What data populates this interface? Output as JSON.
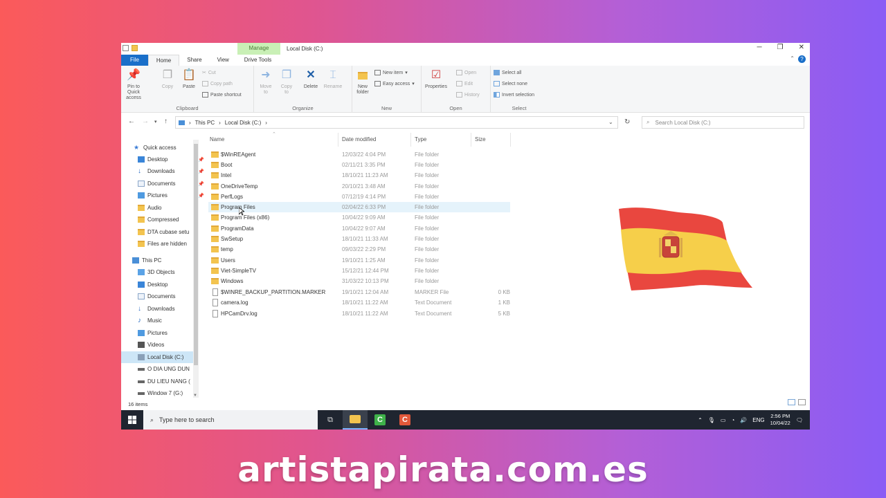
{
  "window": {
    "title": "Local Disk (C:)",
    "manage_tab": "Manage",
    "controls": [
      "─",
      "❐",
      "✕"
    ]
  },
  "ribbon_tabs": [
    "File",
    "Home",
    "Share",
    "View",
    "Drive Tools"
  ],
  "ribbon": {
    "clipboard": {
      "pin_label": "Pin to Quick access",
      "copy": "Copy",
      "paste": "Paste",
      "cut": "Cut",
      "copy_path": "Copy path",
      "paste_shortcut": "Paste shortcut",
      "group": "Clipboard"
    },
    "organize": {
      "move_to": "Move to",
      "copy_to": "Copy to",
      "delete": "Delete",
      "rename": "Rename",
      "group": "Organize"
    },
    "new": {
      "new_folder": "New folder",
      "new_item": "New item",
      "easy_access": "Easy access",
      "group": "New"
    },
    "open": {
      "properties": "Properties",
      "open": "Open",
      "edit": "Edit",
      "history": "History",
      "group": "Open"
    },
    "select": {
      "select_all": "Select all",
      "select_none": "Select none",
      "invert": "Invert selection",
      "group": "Select"
    }
  },
  "address": {
    "path": [
      "This PC",
      "Local Disk (C:)"
    ],
    "search_placeholder": "Search Local Disk (C:)"
  },
  "nav": {
    "quick_access": "Quick access",
    "quick_items": [
      "Desktop",
      "Downloads",
      "Documents",
      "Pictures",
      "Audio",
      "Compressed",
      "DTA cubase setu",
      "Files are hidden"
    ],
    "this_pc": "This PC",
    "pc_items": [
      "3D Objects",
      "Desktop",
      "Documents",
      "Downloads",
      "Music",
      "Pictures",
      "Videos",
      "Local Disk (C:)",
      "O DIA UNG DUN",
      "DU LIEU NANG (",
      "Window 7 (G:)"
    ]
  },
  "columns": {
    "name": "Name",
    "date": "Date modified",
    "type": "Type",
    "size": "Size"
  },
  "files": [
    {
      "name": "$WinREAgent",
      "date": "12/03/22 4:04 PM",
      "type": "File folder",
      "size": ""
    },
    {
      "name": "Boot",
      "date": "02/11/21 3:35 PM",
      "type": "File folder",
      "size": ""
    },
    {
      "name": "Intel",
      "date": "18/10/21 11:23 AM",
      "type": "File folder",
      "size": ""
    },
    {
      "name": "OneDriveTemp",
      "date": "20/10/21 3:48 AM",
      "type": "File folder",
      "size": ""
    },
    {
      "name": "PerfLogs",
      "date": "07/12/19 4:14 PM",
      "type": "File folder",
      "size": ""
    },
    {
      "name": "Program Files",
      "date": "02/04/22 6:33 PM",
      "type": "File folder",
      "size": ""
    },
    {
      "name": "Program Files (x86)",
      "date": "10/04/22 9:09 AM",
      "type": "File folder",
      "size": ""
    },
    {
      "name": "ProgramData",
      "date": "10/04/22 9:07 AM",
      "type": "File folder",
      "size": ""
    },
    {
      "name": "SwSetup",
      "date": "18/10/21 11:33 AM",
      "type": "File folder",
      "size": ""
    },
    {
      "name": "temp",
      "date": "09/03/22 2:29 PM",
      "type": "File folder",
      "size": ""
    },
    {
      "name": "Users",
      "date": "19/10/21 1:25 AM",
      "type": "File folder",
      "size": ""
    },
    {
      "name": "Viet-SimpleTV",
      "date": "15/12/21 12:44 PM",
      "type": "File folder",
      "size": ""
    },
    {
      "name": "Windows",
      "date": "31/03/22 10:13 PM",
      "type": "File folder",
      "size": ""
    },
    {
      "name": "$WINRE_BACKUP_PARTITION.MARKER",
      "date": "19/10/21 12:04 AM",
      "type": "MARKER File",
      "size": "0 KB"
    },
    {
      "name": "camera.log",
      "date": "18/10/21 11:22 AM",
      "type": "Text Document",
      "size": "1 KB"
    },
    {
      "name": "HPCamDrv.log",
      "date": "18/10/21 11:22 AM",
      "type": "Text Document",
      "size": "5 KB"
    }
  ],
  "status": "16 items",
  "taskbar": {
    "search_placeholder": "Type here to search",
    "lang": "ENG",
    "time": "2:56 PM",
    "date": "10/04/22"
  },
  "watermark": "artistapirata.com.es",
  "colors": {
    "accent": "#1a6fc9",
    "manage_tab": "#c9f0b6",
    "selection": "#cde6f7",
    "taskbar": "#1f2530",
    "flag_red": "#e9473f",
    "flag_yellow": "#f6cf4a"
  }
}
